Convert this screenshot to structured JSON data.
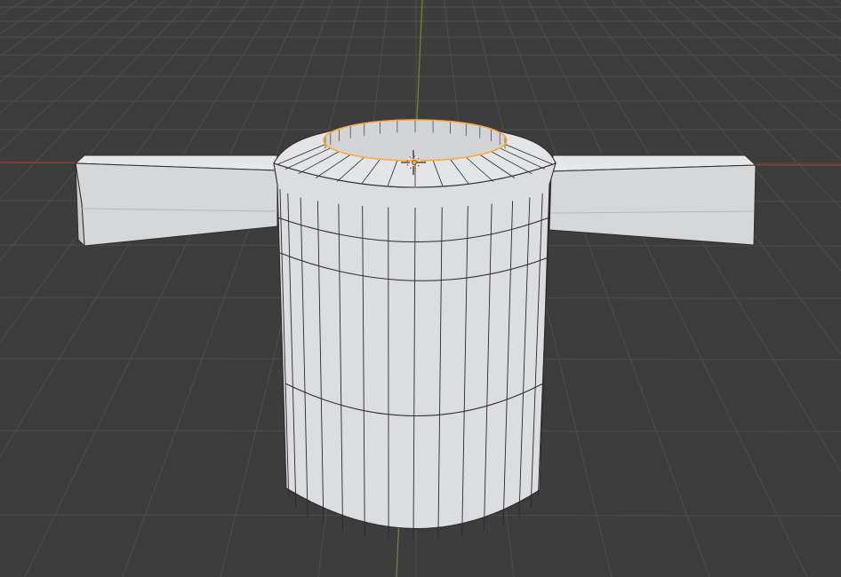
{
  "viewport": {
    "mode": "edit-mode",
    "background_color": "#3d3d3d",
    "grid_color": "#4a4a4a",
    "x_axis_color": "#9b3b3d",
    "y_axis_color": "#6e8a3a",
    "selection_color": "#ffa63d",
    "mesh_fill_color": "#dfe0e2",
    "mesh_edge_color": "#2a2a2a"
  },
  "objects": [
    {
      "name": "cylinder-mesh"
    },
    {
      "name": "bar-mesh"
    }
  ],
  "selection": {
    "element": "top-inner-edge-loop"
  },
  "cursor": {
    "icon": "3d-cursor-icon"
  }
}
